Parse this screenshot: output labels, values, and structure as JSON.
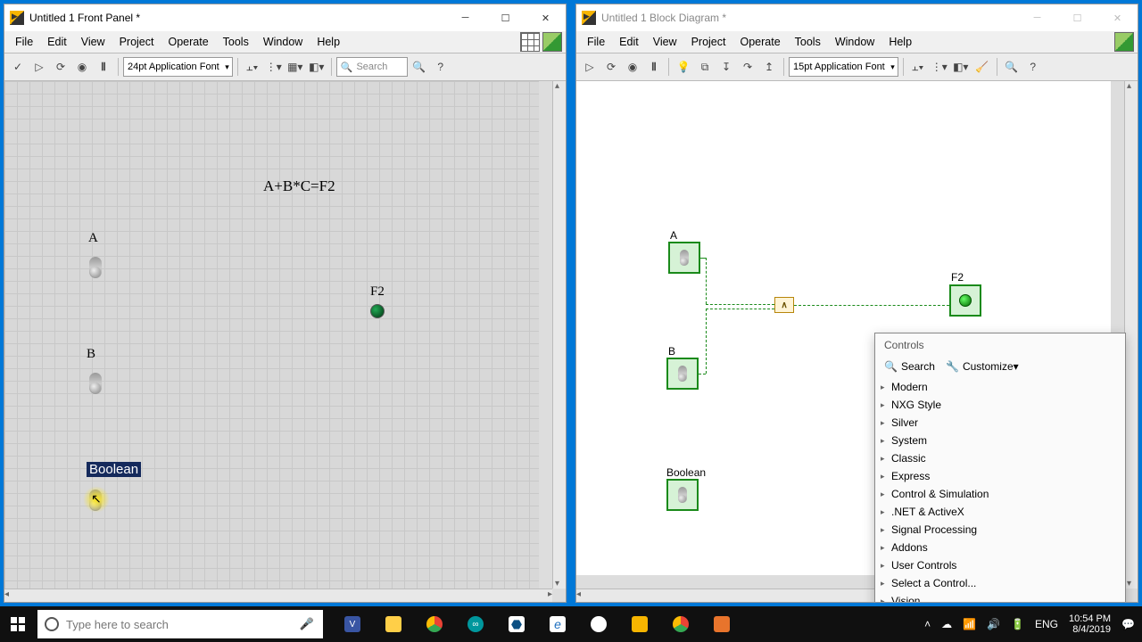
{
  "front_panel": {
    "title": "Untitled 1 Front Panel *",
    "menus": [
      "File",
      "Edit",
      "View",
      "Project",
      "Operate",
      "Tools",
      "Window",
      "Help"
    ],
    "font": "24pt Application Font",
    "search_ph": "Search",
    "equation": "A+B*C=F2",
    "labels": {
      "A": "A",
      "B": "B",
      "F2": "F2",
      "Boolean": "Boolean"
    }
  },
  "block_diagram": {
    "title": "Untitled 1 Block Diagram *",
    "menus": [
      "File",
      "Edit",
      "View",
      "Project",
      "Operate",
      "Tools",
      "Window",
      "Help"
    ],
    "font": "15pt Application Font",
    "labels": {
      "A": "A",
      "B": "B",
      "F2": "F2",
      "Boolean": "Boolean"
    }
  },
  "controls_palette": {
    "title": "Controls",
    "search": "Search",
    "customize": "Customize▾",
    "items": [
      "Modern",
      "NXG Style",
      "Silver",
      "System",
      "Classic",
      "Express",
      "Control & Simulation",
      ".NET & ActiveX",
      "Signal Processing",
      "Addons",
      "User Controls",
      "Select a Control...",
      "Vision"
    ]
  },
  "taskbar": {
    "search_ph": "Type here to search",
    "lang": "ENG",
    "time": "10:54 PM",
    "date": "8/4/2019"
  }
}
